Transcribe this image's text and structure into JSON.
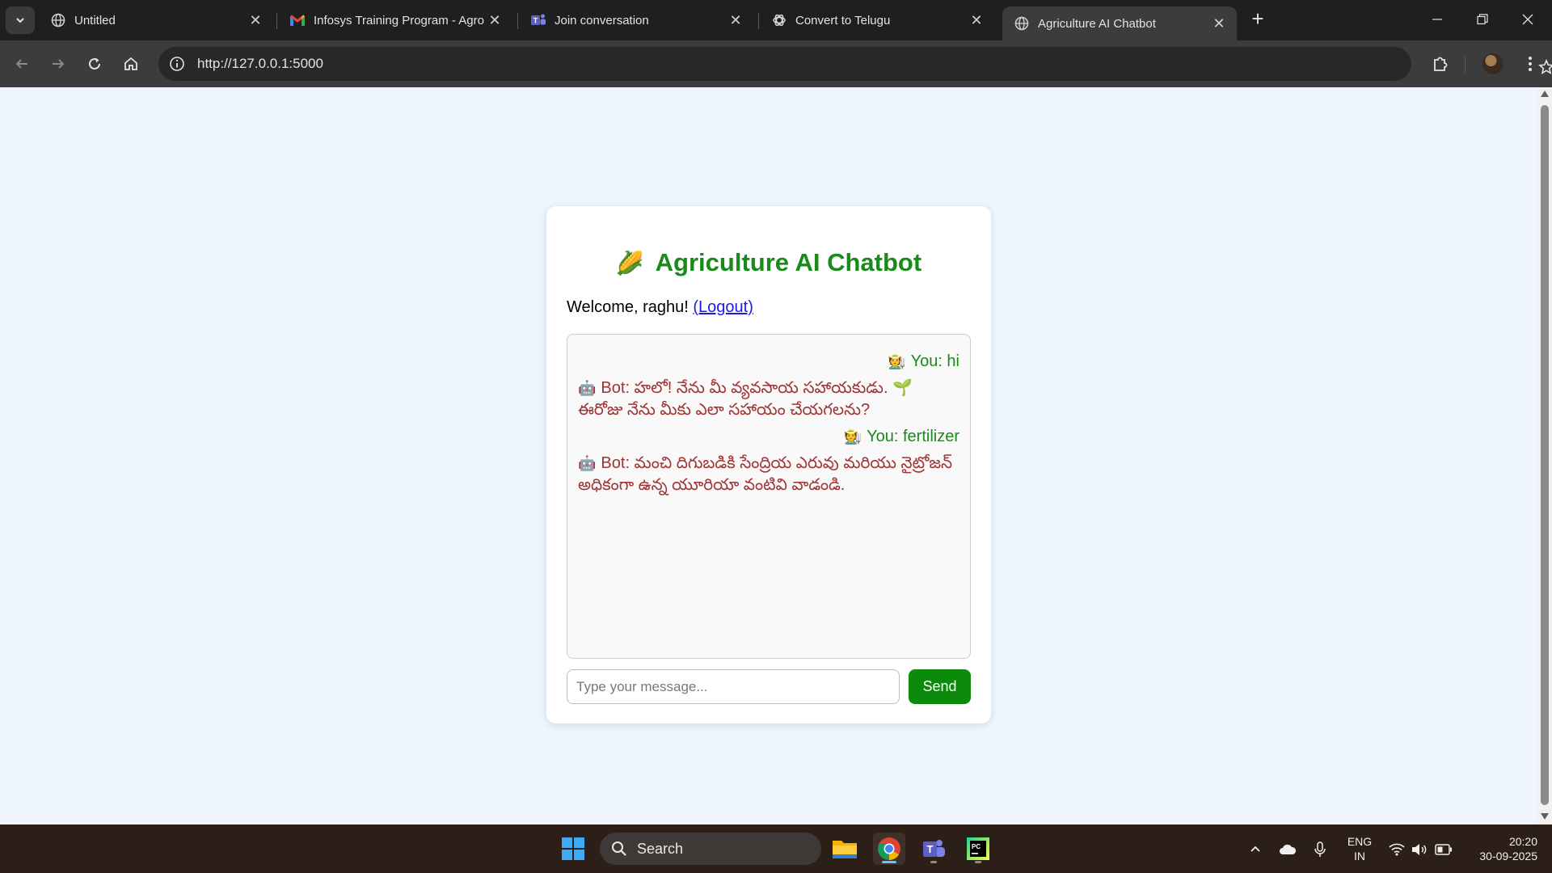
{
  "browser": {
    "tabs": [
      {
        "title": "Untitled",
        "icon": "globe-icon",
        "active": false
      },
      {
        "title": "Infosys Training Program - Agro",
        "icon": "gmail-icon",
        "active": false
      },
      {
        "title": "Join conversation",
        "icon": "teams-icon",
        "active": false
      },
      {
        "title": "Convert to Telugu",
        "icon": "openai-icon",
        "active": false
      },
      {
        "title": "Agriculture AI Chatbot",
        "icon": "globe-icon",
        "active": true
      }
    ],
    "url": "http://127.0.0.1:5000"
  },
  "app": {
    "title": "Agriculture AI Chatbot",
    "title_emoji": "🌽",
    "welcome_text": "Welcome, raghu!",
    "logout_label": "(Logout)",
    "messages": [
      {
        "sender": "user",
        "emoji": "🧑‍🌾",
        "text": "You: hi"
      },
      {
        "sender": "bot",
        "emoji": "🤖",
        "text": "Bot: హలో! నేను మీ వ్యవసాయ సహాయకుడు. 🌱 ఈరోజు నేను మీకు ఎలా సహాయం చేయగలను?"
      },
      {
        "sender": "user",
        "emoji": "🧑‍🌾",
        "text": "You: fertilizer"
      },
      {
        "sender": "bot",
        "emoji": "🤖",
        "text": "Bot: మంచి దిగుబడికి సేంద్రియ ఎరువు మరియు నైట్రోజన్ అధికంగా ఉన్న యూరియా వంటివి వాడండి."
      }
    ],
    "input_placeholder": "Type your message...",
    "input_value": "",
    "send_label": "Send",
    "colors": {
      "title": "#1a8a1a",
      "user_message": "#1a8a1a",
      "bot_message": "#a03232",
      "send_button": "#0b8a0b",
      "page_bg": "#eef5fe"
    }
  },
  "taskbar": {
    "search_label": "Search",
    "apps": [
      "windows-start-icon",
      "file-explorer-icon",
      "chrome-icon",
      "teams-icon",
      "pycharm-icon"
    ],
    "language_line1": "ENG",
    "language_line2": "IN",
    "time": "20:20",
    "date": "30-09-2025"
  }
}
